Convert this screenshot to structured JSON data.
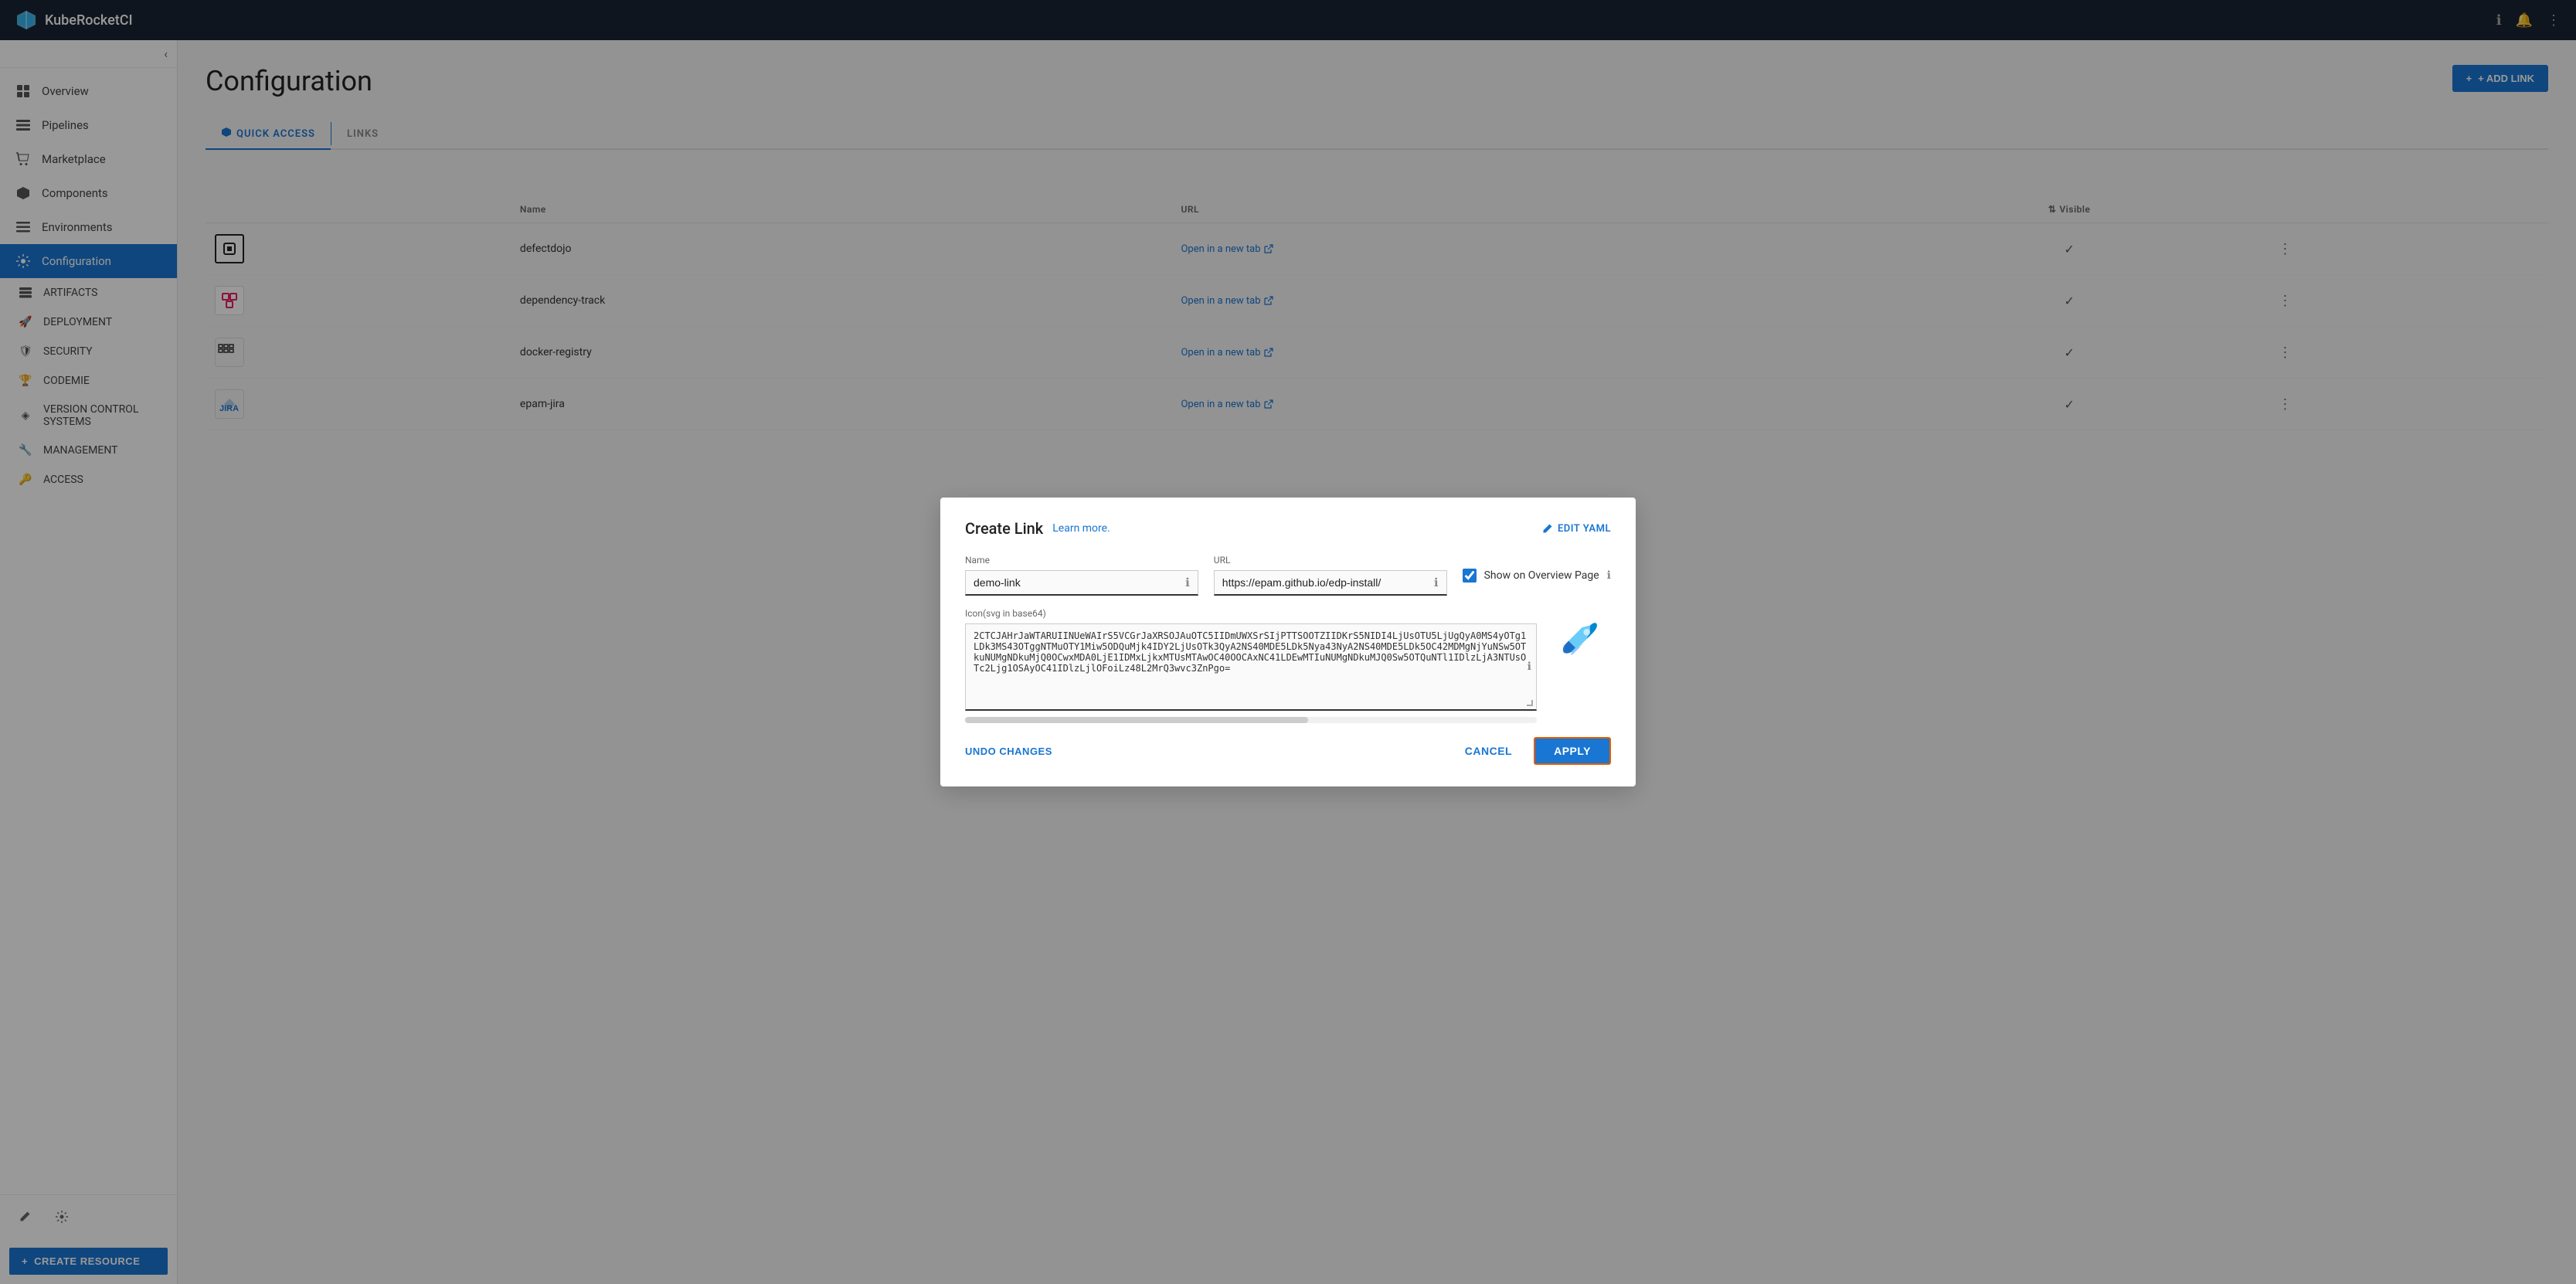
{
  "app": {
    "name": "KubeRocketCI"
  },
  "topbar": {
    "info_icon": "ℹ",
    "bell_icon": "🔔",
    "menu_icon": "⋮"
  },
  "sidebar": {
    "collapse_icon": "‹",
    "items": [
      {
        "id": "overview",
        "label": "Overview",
        "icon": "▦"
      },
      {
        "id": "pipelines",
        "label": "Pipelines",
        "icon": "▬"
      },
      {
        "id": "marketplace",
        "label": "Marketplace",
        "icon": "🛒"
      },
      {
        "id": "components",
        "label": "Components",
        "icon": "❖"
      },
      {
        "id": "environments",
        "label": "Environments",
        "icon": "≡"
      },
      {
        "id": "configuration",
        "label": "Configuration",
        "icon": "⚙",
        "active": true
      }
    ],
    "sub_items": [
      {
        "id": "artifacts",
        "label": "ARTIFACTS",
        "icon": "▤"
      },
      {
        "id": "deployment",
        "label": "DEPLOYMENT",
        "icon": "🚀"
      },
      {
        "id": "security",
        "label": "SECURITY",
        "icon": "🛡"
      },
      {
        "id": "codemie",
        "label": "CODEMIE",
        "icon": "🏆"
      },
      {
        "id": "version-control",
        "label": "VERSION CONTROL SYSTEMS",
        "icon": "◈"
      },
      {
        "id": "management",
        "label": "MANAGEMENT",
        "icon": "🔧"
      },
      {
        "id": "access",
        "label": "ACCESS",
        "icon": "🔑"
      }
    ],
    "footer": {
      "edit_icon": "✏",
      "settings_icon": "⚙"
    },
    "create_resource_label": "CREATE RESOURCE"
  },
  "page": {
    "title": "Configuration",
    "tabs": [
      {
        "id": "quick-access",
        "label": "QUICK ACCESS",
        "active": true
      },
      {
        "id": "links",
        "label": "LINKS"
      }
    ]
  },
  "add_link_button": "+ ADD LINK",
  "table": {
    "columns": [
      "",
      "Name",
      "URL",
      "Visible"
    ],
    "rows": [
      {
        "icon": "⬛",
        "name": "defectdojo",
        "url_label": "Open in a new tab",
        "visible": true
      },
      {
        "icon": "⬜",
        "name": "dependency-track",
        "url_label": "Open in a new tab",
        "visible": true
      },
      {
        "icon": "🖨",
        "name": "docker-registry",
        "url_label": "Open in a new tab",
        "visible": true
      },
      {
        "icon": "🦾",
        "name": "epam-jira",
        "url_label": "Open in a new tab",
        "visible": true
      }
    ]
  },
  "modal": {
    "title": "Create Link",
    "learn_more": "Learn more.",
    "edit_yaml": "EDIT YAML",
    "name_label": "Name",
    "name_value": "demo-link",
    "url_label": "URL",
    "url_value": "https://epam.github.io/edp-install/",
    "show_overview_label": "Show on Overview Page",
    "icon_label": "Icon(svg in base64)",
    "icon_value": "2CTCJAHrJaWTARUIINUeWAIrS5VCGrJaXRSOJAuOTC5IIDmUWXSrSIjPTTSOOTZIIDKrS5NIDI4LjUsOTU5LjUgQyA0MS4yOTg1LDk3MS43OTggNTMuOTY1Miw5ODQuMjk4IDY2LjUsOTk3QyA2NS40MDE5LDk5Nya43NyA2NS40MDE5LDk5OC42MDMgNjYuNSw5OTkuNUMgNDkuMjQ0OCwxMDA0LjE1IDMxLjkxMTUsMTAwOC40OOCAxNC41LDEwMTIuNUMgNDkuMJQ0Sw5OTQuNTl1IDlzLjA3NTUsOTc2Ljg1OSAyOC41IDlzLjlOFoiLz48L2MrQ3wvc3ZnPgo=",
    "undo_label": "UNDO CHANGES",
    "cancel_label": "CANCEL",
    "apply_label": "APPLY"
  }
}
